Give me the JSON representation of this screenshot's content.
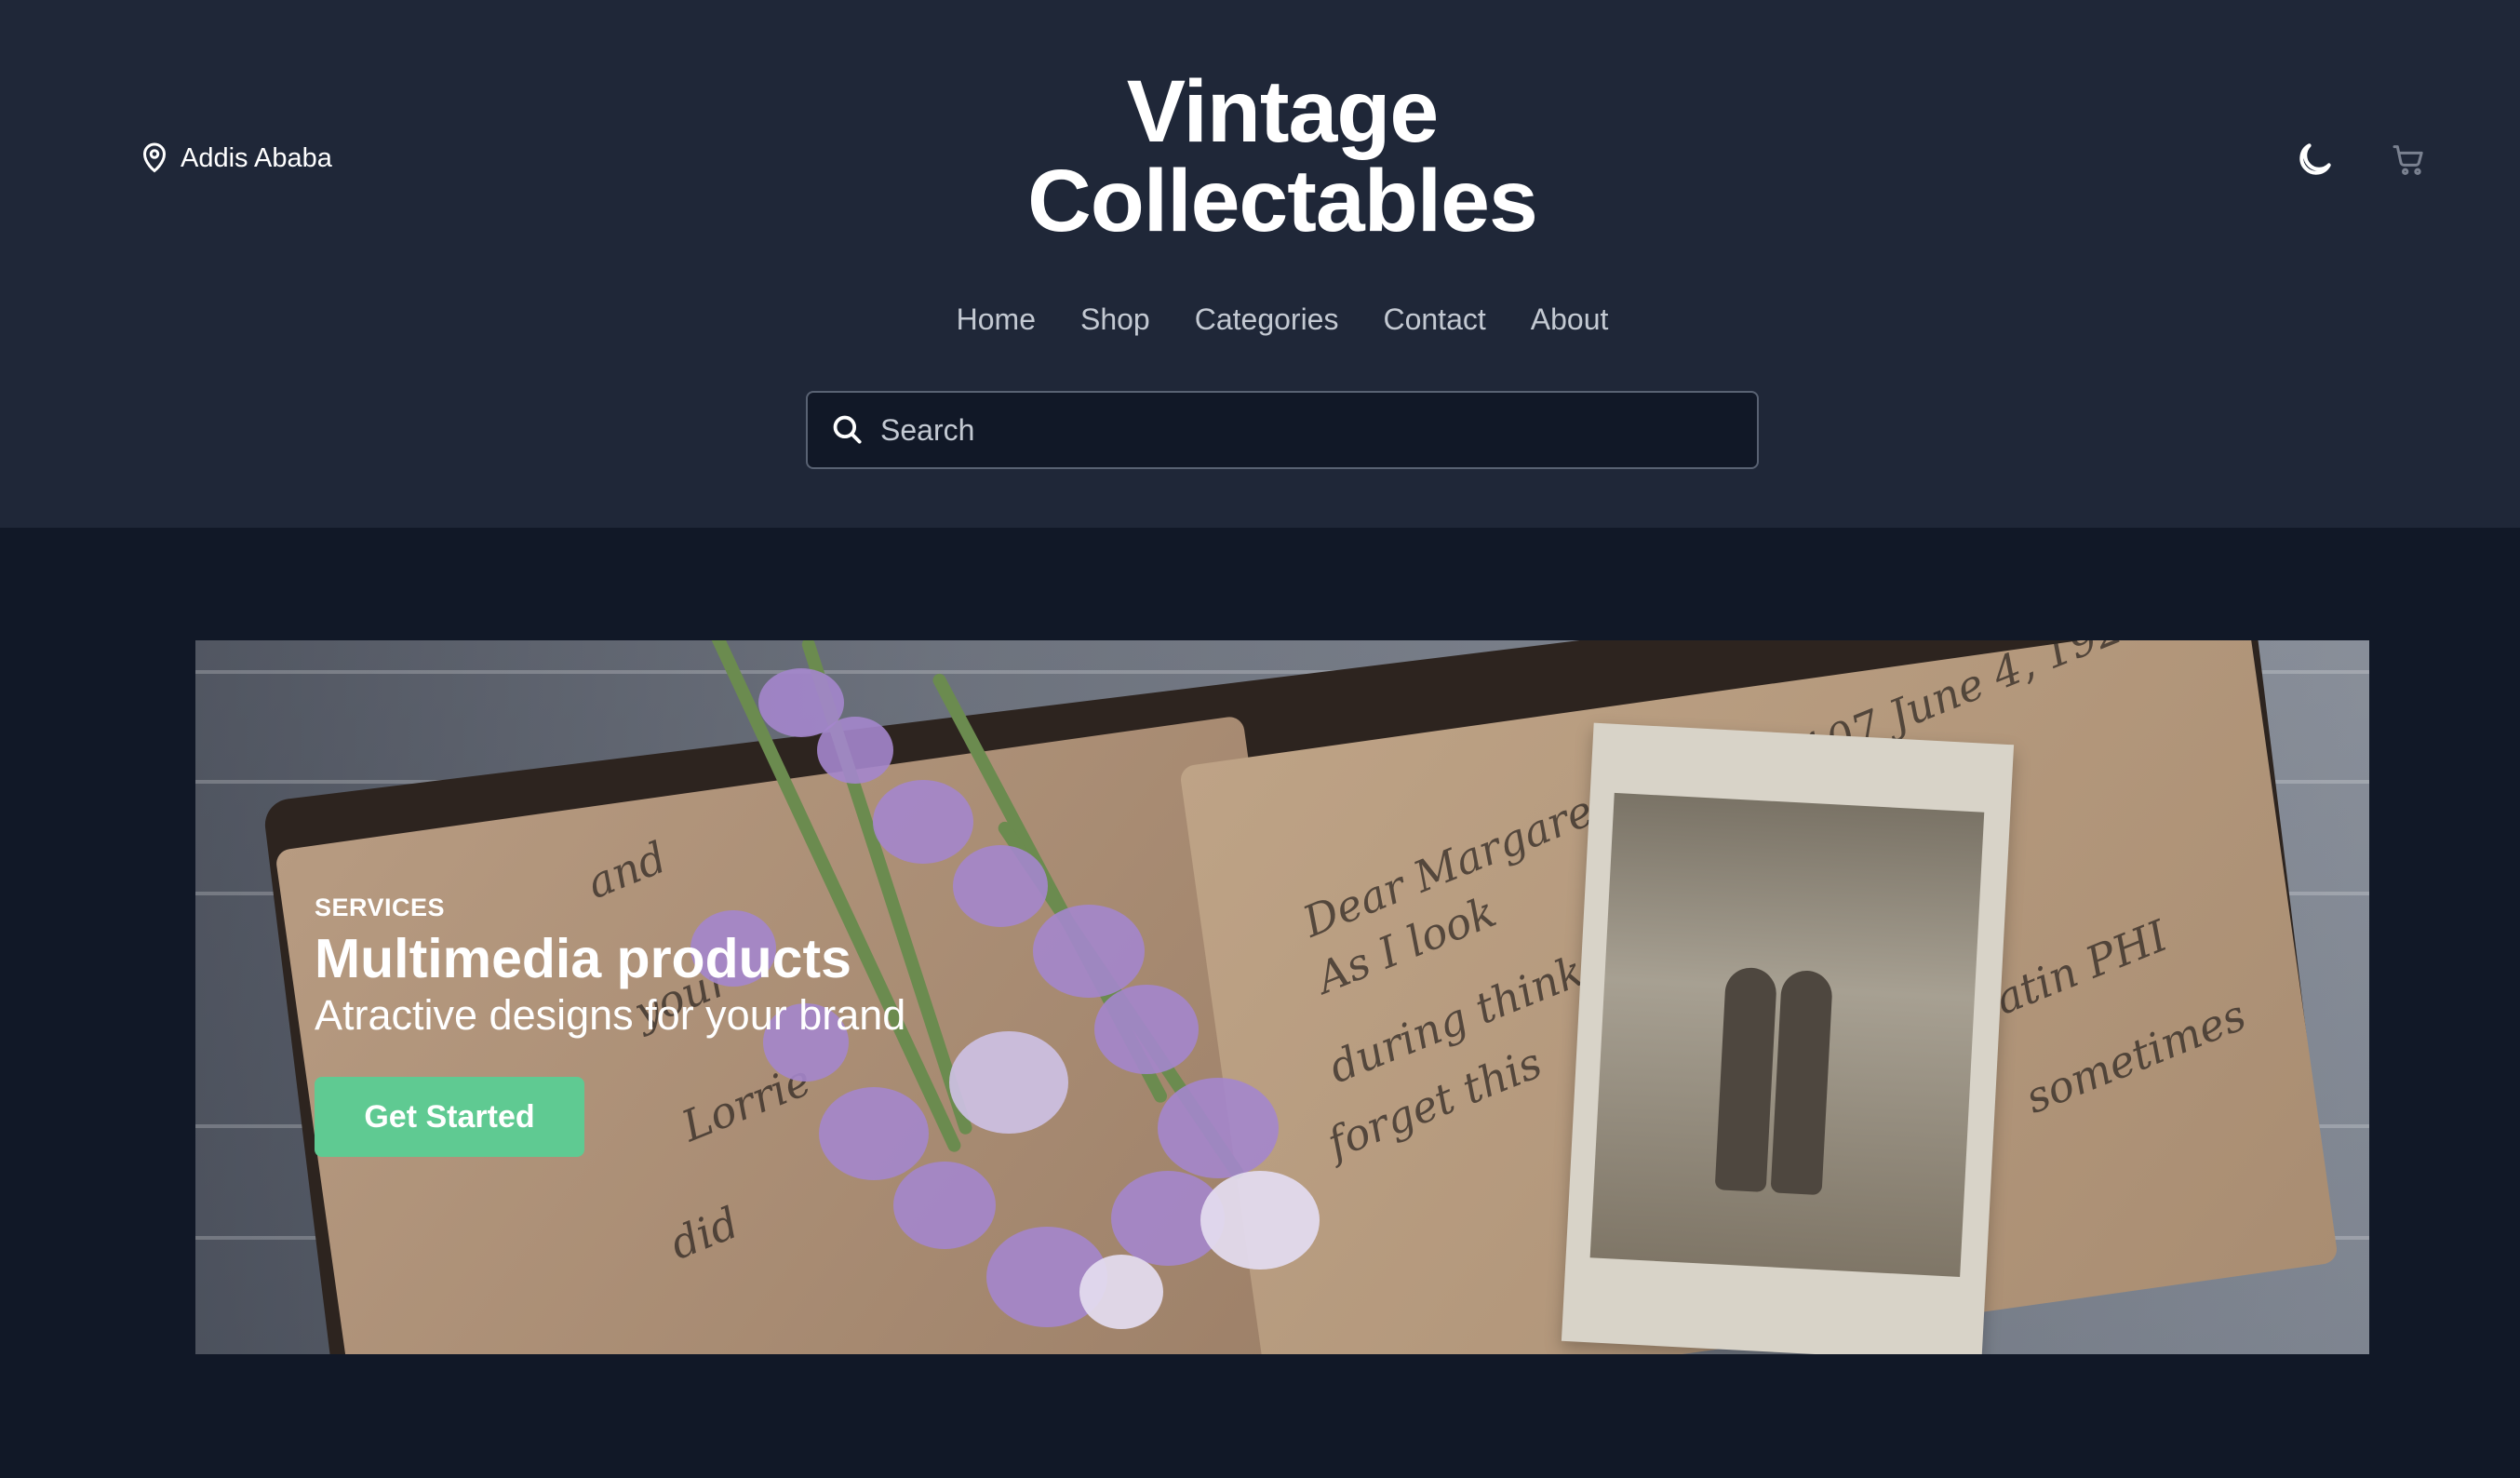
{
  "header": {
    "location": "Addis Ababa",
    "brand": {
      "line1": "Vintage",
      "line2": "Collectables"
    },
    "nav": [
      "Home",
      "Shop",
      "Categories",
      "Contact",
      "About"
    ],
    "search": {
      "placeholder": "Search",
      "value": ""
    },
    "icons": {
      "location": "map-pin-icon",
      "theme": "moon-icon",
      "cart": "cart-icon",
      "search": "search-icon"
    }
  },
  "hero": {
    "eyebrow": "SERVICES",
    "title": "Multimedia products",
    "subtitle": "Atractive designs for your brand",
    "button_label": "Get Started",
    "image_description": "vintage-journal-photo-flowers"
  },
  "colors": {
    "page_background": "#111827",
    "header_background": "#1f2738",
    "accent": "#5fca92",
    "nav_text": "#c3c9d2",
    "search_border": "#596273"
  }
}
